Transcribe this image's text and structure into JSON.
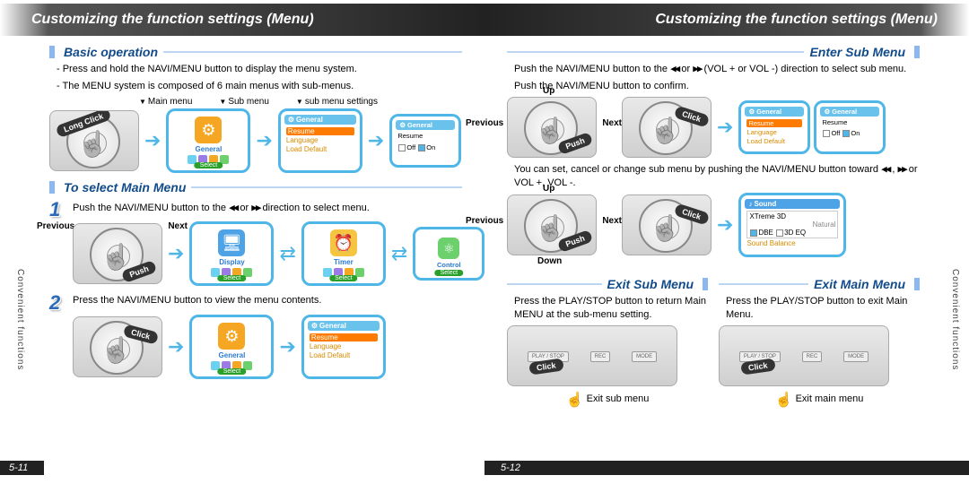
{
  "title": "Customizing the function settings (Menu)",
  "side_tab": "Convenient functions",
  "page_left_num": "5-11",
  "page_right_num": "5-12",
  "left": {
    "basic_head": "Basic operation",
    "basic_b1": "- Press and hold the NAVI/MENU button to display the menu system.",
    "basic_b2": "- The MENU system is composed of 6 main menus with sub-menus.",
    "col1": "Main menu",
    "col2": "Sub menu",
    "col3": "sub menu settings",
    "badge_long_click": "Long Click",
    "tile_general": "General",
    "select_label": "Select",
    "menu_items": {
      "resume": "Resume",
      "language": "Language",
      "load_default": "Load Default"
    },
    "resume_off": "Off",
    "resume_on": "On",
    "select_main_head": "To select Main Menu",
    "step1_text_a": "Push the NAVI/MENU button to the ",
    "step1_text_b": " or ",
    "step1_text_c": " direction to select menu.",
    "previous": "Previous",
    "next": "Next",
    "badge_push": "Push",
    "tile_display": "Display",
    "tile_timer": "Timer",
    "tile_control": "Control",
    "step2_text": "Press the NAVI/MENU button to view the menu contents.",
    "badge_click": "Click"
  },
  "right": {
    "enter_head": "Enter Sub Menu",
    "enter_line1_a": "Push the NAVI/MENU button to the ",
    "enter_line1_b": " or ",
    "enter_line1_c": " (VOL + or VOL -) direction to select sub menu.",
    "enter_line2": "Push the NAVI/MENU button to confirm.",
    "up": "Up",
    "down": "Down",
    "previous": "Previous",
    "next": "Next",
    "badge_push": "Push",
    "badge_click": "Click",
    "change_line_a": "You can set, cancel or change sub menu by pushing the NAVI/MENU button toward ",
    "change_line_b": " , ",
    "change_line_c": " or VOL +, VOL -.",
    "sound_head": "Sound",
    "sound_items": {
      "xtreme": "XTreme 3D",
      "natural": "Natural",
      "dbe": "DBE",
      "eq": "3D EQ",
      "balance": "Sound Balance"
    },
    "exit_sub_head": "Exit Sub Menu",
    "exit_sub_body": "Press the PLAY/STOP button to return Main MENU at the sub-menu setting.",
    "exit_sub_caption": "Exit sub menu",
    "exit_main_head": "Exit Main Menu",
    "exit_main_body": "Press the PLAY/STOP button to exit Main Menu.",
    "exit_main_caption": "Exit main menu",
    "device_btn_play": "PLAY / STOP",
    "device_btn_rec": "REC",
    "device_btn_mode": "MODE"
  }
}
